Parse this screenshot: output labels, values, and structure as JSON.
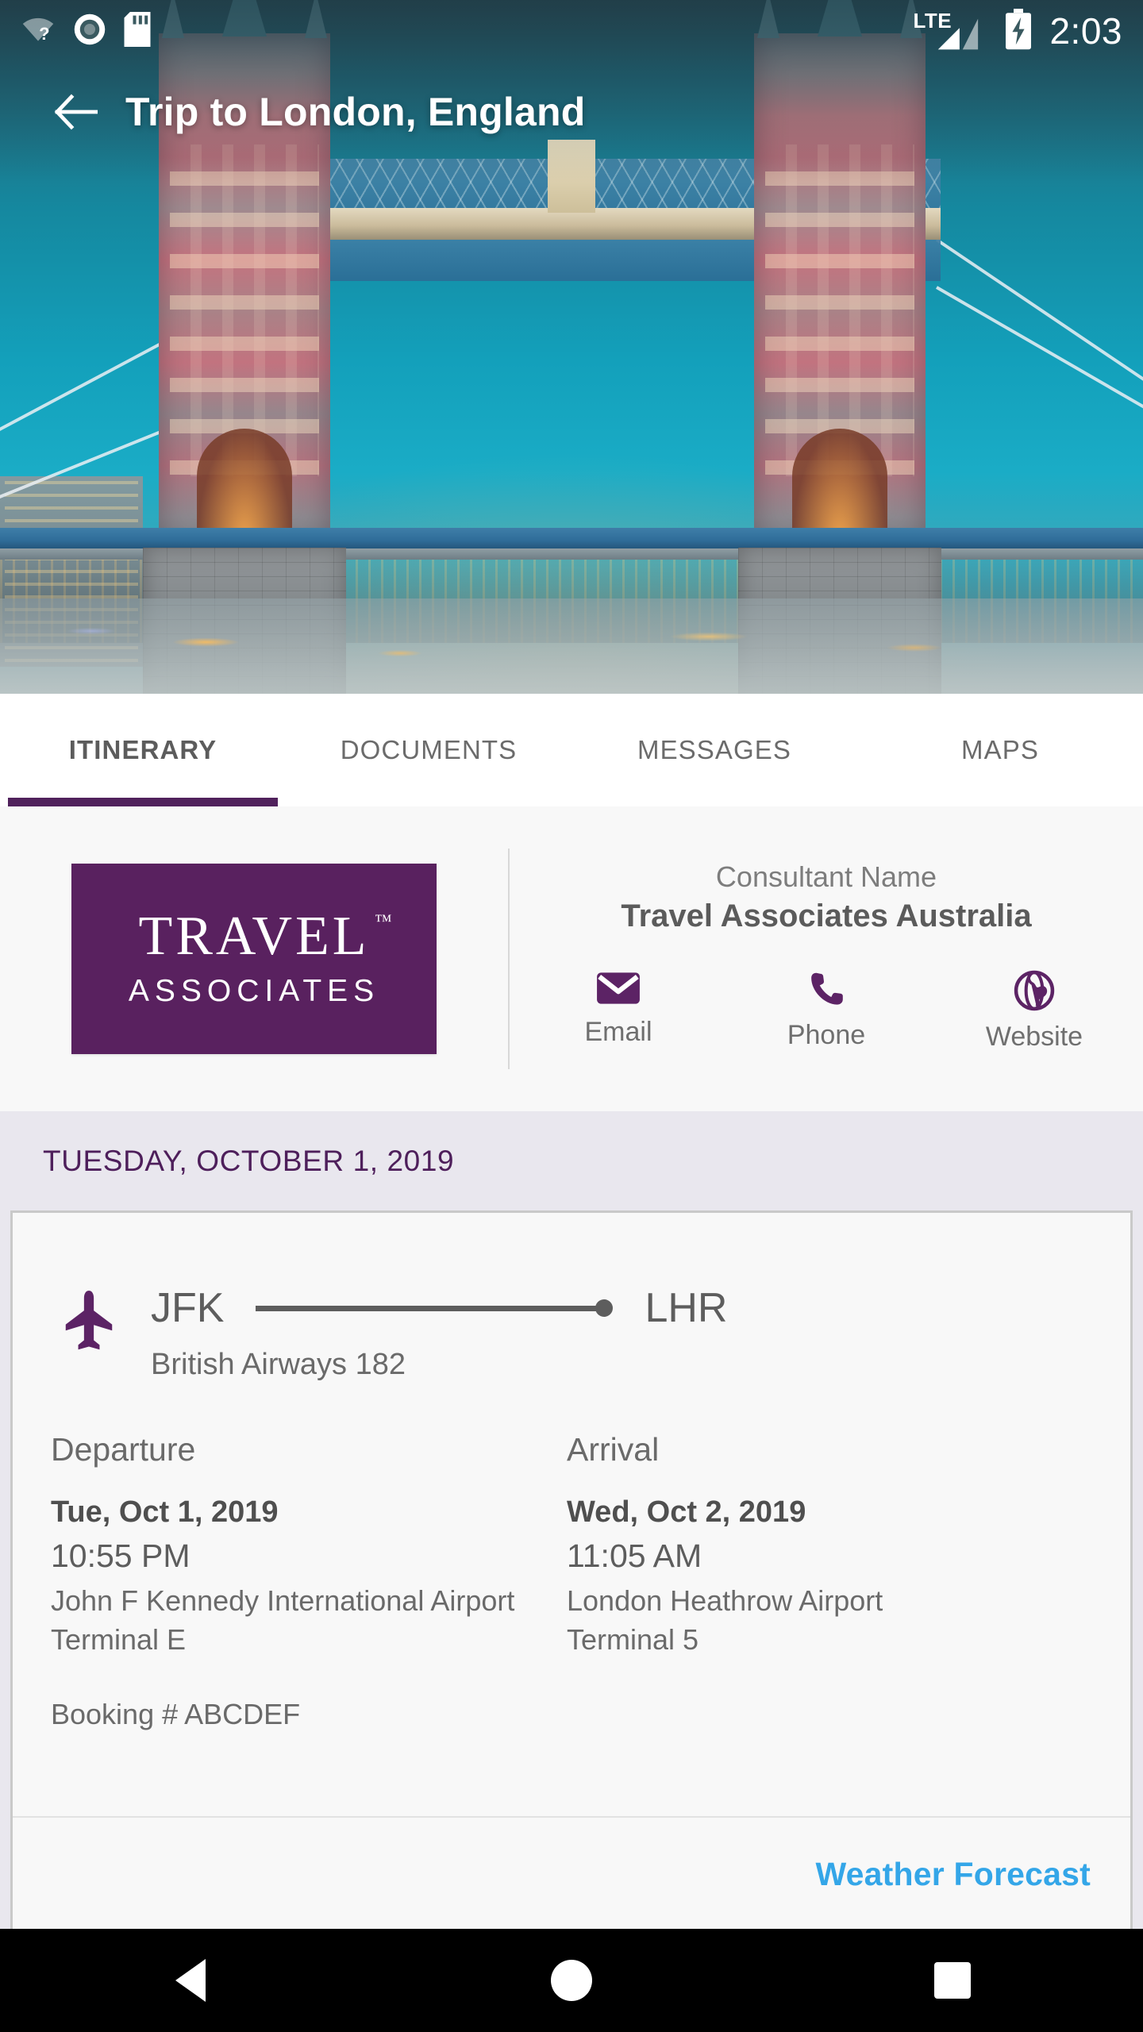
{
  "status_bar": {
    "icons": [
      "wifi-unknown-icon",
      "record-circle-icon",
      "sd-card-icon"
    ],
    "network_label": "LTE",
    "signal_icon": "signal-bars-icon",
    "battery_icon": "battery-charging-icon",
    "time": "2:03"
  },
  "app_bar": {
    "back_icon": "back-arrow-icon",
    "title": "Trip to London, England"
  },
  "hero": {
    "image_alt": "Tower Bridge London at dusk"
  },
  "tabs": [
    {
      "label": "ITINERARY",
      "active": true
    },
    {
      "label": "DOCUMENTS",
      "active": false
    },
    {
      "label": "MESSAGES",
      "active": false
    },
    {
      "label": "MAPS",
      "active": false
    }
  ],
  "consultant": {
    "logo_top": "TRAVEL",
    "logo_tm": "™",
    "logo_bottom": "ASSOCIATES",
    "label": "Consultant Name",
    "name": "Travel Associates Australia",
    "actions": [
      {
        "label": "Email",
        "icon": "email-icon"
      },
      {
        "label": "Phone",
        "icon": "phone-icon"
      },
      {
        "label": "Website",
        "icon": "globe-icon"
      }
    ]
  },
  "itinerary": {
    "date_header": "TUESDAY, OCTOBER 1, 2019",
    "flight": {
      "icon": "airplane-icon",
      "origin_code": "JFK",
      "destination_code": "LHR",
      "airline_flight": "British Airways 182",
      "departure": {
        "title": "Departure",
        "date": "Tue, Oct 1, 2019",
        "time": "10:55 PM",
        "airport": "John F Kennedy International Airport",
        "terminal": "Terminal E"
      },
      "arrival": {
        "title": "Arrival",
        "date": "Wed, Oct 2, 2019",
        "time": "11:05 AM",
        "airport": "London Heathrow Airport",
        "terminal": "Terminal 5"
      },
      "booking": "Booking # ABCDEF",
      "weather_link": "Weather Forecast"
    }
  },
  "nav_bar": {
    "back": "nav-back-icon",
    "home": "nav-home-icon",
    "recents": "nav-recents-icon"
  },
  "colors": {
    "brand_purple": "#50215C",
    "logo_purple": "#59215F",
    "date_band": "#E9E7EE",
    "link_blue": "#34A6E8",
    "text_gray": "#5D5D5D"
  }
}
